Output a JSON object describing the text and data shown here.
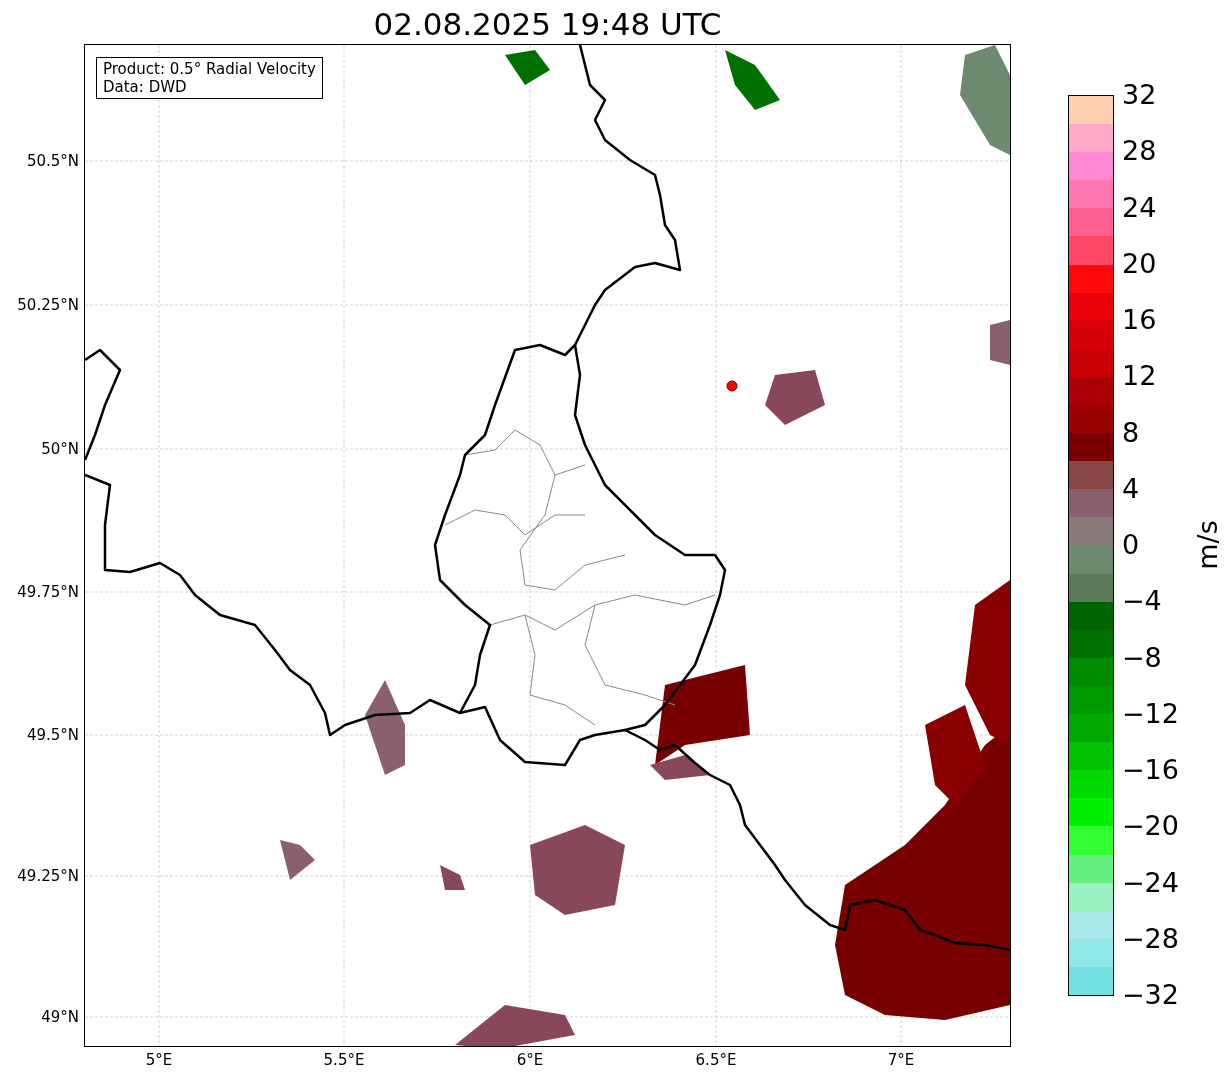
{
  "title": "02.08.2025 19:48 UTC",
  "legend": [
    "Product: 0.5° Radial Velocity",
    "Data: DWD"
  ],
  "yticks": [
    "50.5°N",
    "50.25°N",
    "50°N",
    "49.75°N",
    "49.5°N",
    "49.25°N",
    "49°N"
  ],
  "xticks": [
    "5°E",
    "5.5°E",
    "6°E",
    "6.5°E",
    "7°E"
  ],
  "colorbar": {
    "label": "m/s",
    "ticks": [
      "32",
      "28",
      "24",
      "20",
      "16",
      "12",
      "8",
      "4",
      "0",
      "−4",
      "−8",
      "−12",
      "−16",
      "−20",
      "−24",
      "−28",
      "−32"
    ],
    "bands": [
      {
        "color": "#ffcfb0"
      },
      {
        "color": "#ffa8c8"
      },
      {
        "color": "#ff88d4"
      },
      {
        "color": "#ff77b0"
      },
      {
        "color": "#ff6090"
      },
      {
        "color": "#ff4866"
      },
      {
        "color": "#ff0a0a"
      },
      {
        "color": "#e80008"
      },
      {
        "color": "#d60008"
      },
      {
        "color": "#c80006"
      },
      {
        "color": "#a80004"
      },
      {
        "color": "#980000"
      },
      {
        "color": "#780000"
      },
      {
        "color": "#884848"
      },
      {
        "color": "#886070"
      },
      {
        "color": "#887878"
      },
      {
        "color": "#6e8a6e"
      },
      {
        "color": "#5a7a5a"
      },
      {
        "color": "#006400"
      },
      {
        "color": "#007000"
      },
      {
        "color": "#008a00"
      },
      {
        "color": "#009800"
      },
      {
        "color": "#00a800"
      },
      {
        "color": "#00c000"
      },
      {
        "color": "#00d800"
      },
      {
        "color": "#00f000"
      },
      {
        "color": "#33ff33"
      },
      {
        "color": "#66f080"
      },
      {
        "color": "#99f0c0"
      },
      {
        "color": "#a8e8e8"
      },
      {
        "color": "#90e8e8"
      },
      {
        "color": "#70e0e0"
      }
    ]
  }
}
